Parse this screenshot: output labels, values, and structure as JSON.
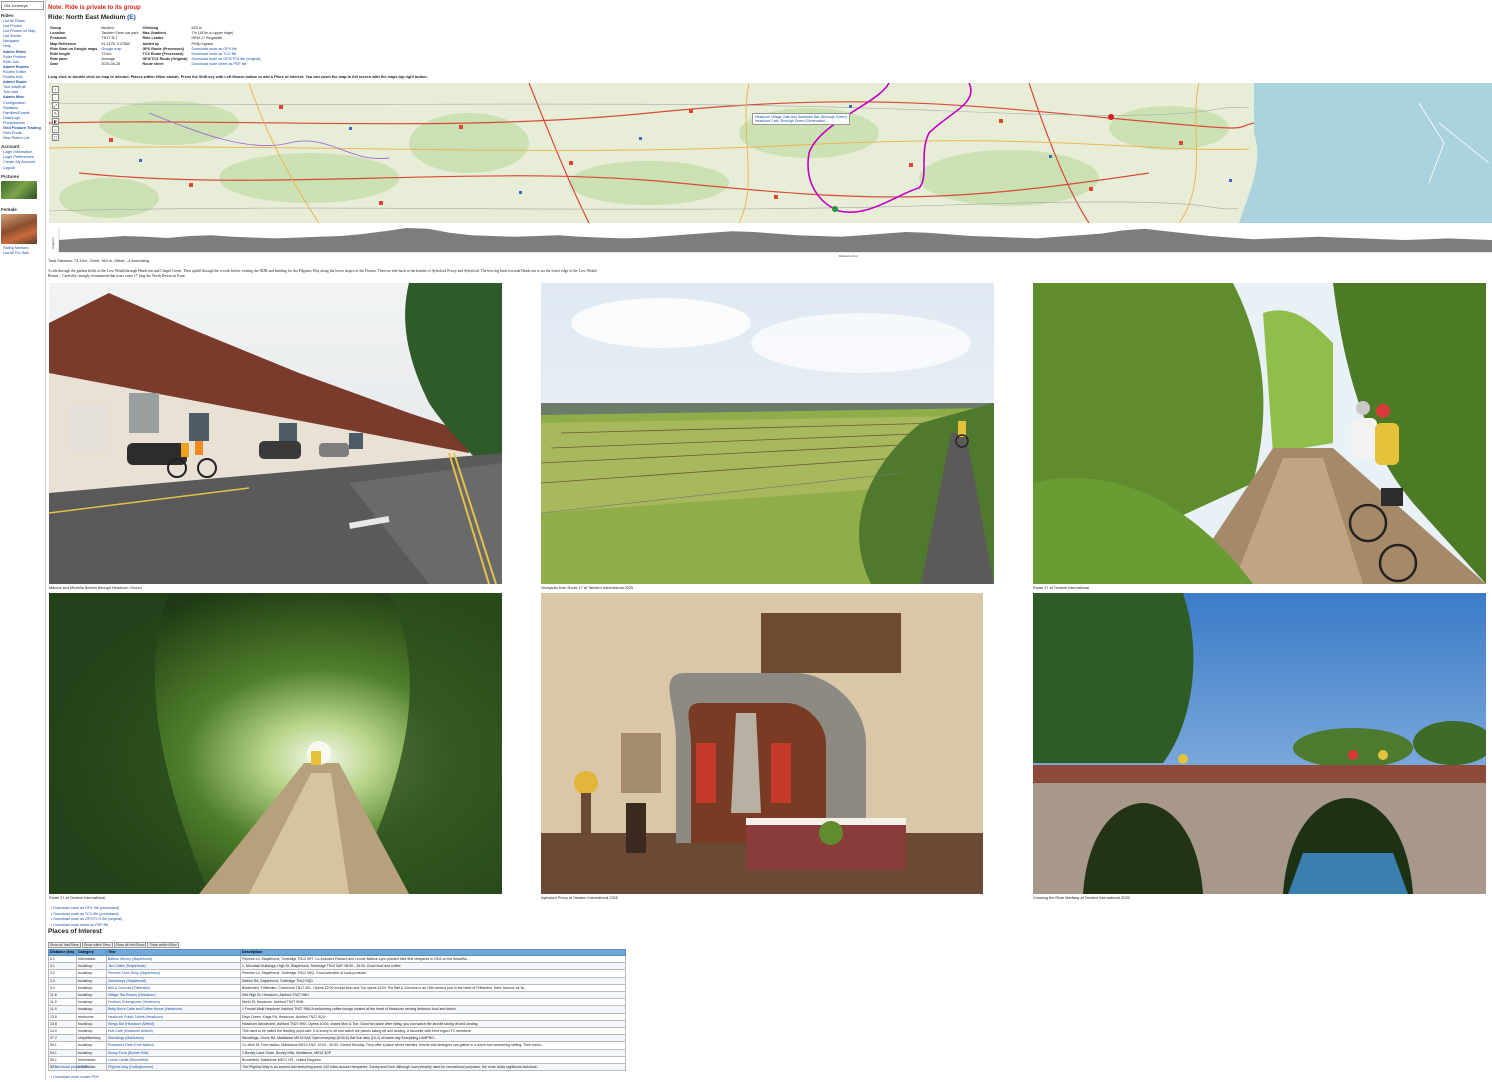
{
  "sidebar": {
    "top_link": "Old Journeys",
    "rides_heading": "Rides",
    "rides_items": [
      "List All Rides",
      "List Photos",
      "List Photos on Map",
      "List Shorts",
      "Navigator",
      "Help",
      "Admin Rides",
      "Rider Profiles",
      "Ride Join",
      "Admin Routes",
      "Routes Editor",
      "Routes Add",
      "Admin Route",
      "Tour Add/Edit",
      "Tour Add",
      "Admin Misc",
      "Configuration",
      "Statistics",
      "Families/Emails",
      "Data/Logs",
      "Photo/Issues",
      "Grid Posture Trading",
      "Path Route",
      "New Riders List"
    ],
    "account_heading": "Account",
    "account_items": [
      "Login Information",
      "Login Preferences",
      "Create My Account",
      "Logout"
    ],
    "pictures_heading": "Pictures",
    "female_heading": "Female",
    "bottom_items": [
      "Riding Mentors",
      "List All For Sale"
    ]
  },
  "page": {
    "note": "Note: Ride is private to its group",
    "title_prefix": "Ride: North East Medium",
    "title_code": "(E)"
  },
  "info_rows": [
    {
      "k1": "Group",
      "v1": "tandem",
      "k2": "Climbing",
      "v2": "625 m"
    },
    {
      "k1": "Location",
      "v1": "Tandem Farm car park",
      "k2": "Max Gradient",
      "v2": "7% (192m to upper ridge)"
    },
    {
      "k1": "Postcode",
      "v1": "TN17 3LT",
      "k2": "Ride Leader",
      "v2": "HRM 17 Kingsdale"
    },
    {
      "k1": "Map Reference",
      "v1": "51.1476, 0.47860",
      "k2": "Added by",
      "v2": "Philip Ingram"
    },
    {
      "k1": "Ride Start on Google maps",
      "v1": "Google map",
      "k2": "GPX Route (Processed)",
      "v2": "Download route as GPX file"
    },
    {
      "k1": "Ride length",
      "v1": "73 km",
      "k2": "TCX Route (Processed)",
      "v2": "Download route as TCX file"
    },
    {
      "k1": "Ride pace",
      "v1": "Average",
      "k2": "GPX/TCX Route (Original)",
      "v2": "Download route as GPX/TCX file (original)"
    },
    {
      "k1": "Date",
      "v1": "2025-06-28",
      "k2": "Route sheet",
      "v2": "Download route sheet as PDF file"
    }
  ],
  "map_hint": "Long click or double click on map to interact. Places within 60km shown. Press the Shift key with Left Mouse button to add a Place of Interest. You can zoom the map to full screen with the maps top right button.",
  "map": {
    "tooltip_line1": "Headcorn Village Cafe And Sandwich Bar (Borough Green)",
    "tooltip_line2": "Headcorn Cafe, Borough Green (Sevenoaks)",
    "controls": [
      "+",
      "−",
      "⤢",
      "✎",
      "◧",
      "⌂",
      "▢"
    ]
  },
  "elevation": {
    "ylabel": "Height m",
    "xlabel": "Distance (km)",
    "profile": [
      30,
      34,
      36,
      40,
      38,
      35,
      40,
      42,
      38,
      36,
      34,
      36,
      38,
      40,
      45,
      52,
      60,
      58,
      48,
      42,
      40,
      38,
      40,
      42,
      38,
      36,
      34,
      36,
      40,
      44,
      48,
      52,
      50,
      46,
      42,
      40,
      38,
      42,
      46,
      50,
      48,
      44,
      40,
      38,
      36,
      34,
      38,
      42,
      46,
      54,
      58,
      52,
      46,
      40,
      36,
      32,
      34,
      36,
      38,
      36,
      34,
      32,
      30,
      32,
      34,
      32,
      30
    ]
  },
  "distance_line": "Total Distance: 73.3 km, Climb: 964 m, Offset: –4 Ascending",
  "description": "A ride through the garden fields of the Low Weald through Headcorn and Chapel Green. Then uphill through the woods before visiting the NDR and heading for the Pilgrims Way along the lower slopes of the Downs. Then we ride back to the hamlet of Aylesford Priory and Aylesford. The best leg back towards Headcorn is via the lower edge of the Low Weald.",
  "description2": "Return – Carefully strongly recommend that users route 17 long the North Downs in Kent",
  "photos": [
    {
      "caption": "Marcus and Michelle Beeton through Headcorn Church"
    },
    {
      "caption": "Vineyards from Route 17 at Tandem International 2025"
    },
    {
      "caption": "Route 17 at Tandem International"
    },
    {
      "caption": "Route 17 at Tandem International"
    },
    {
      "caption": "Aylesford Priory at Tandem International 2025"
    },
    {
      "caption": "Crossing the River Medway at Tandem International 2025"
    }
  ],
  "downloads": [
    "Download route as GPX file (processed)",
    "Download route as TCX file (processed)",
    "Download route as GPX/TCX file (original)",
    "Download route sheet as PDF file"
  ],
  "poi": {
    "heading": "Places of Interest",
    "buttons": [
      "Show all Info/Show",
      "Show within Desc",
      "Show all Info/Show",
      "Show within 60km"
    ],
    "columns": [
      "Distance (km)",
      "Category",
      "Title",
      "Description"
    ],
    "rows": [
      [
        "0.1",
        "Information",
        "Balfour Winery (Staplehurst)",
        "Pennies Ln, Staplehurst, Tonbridge TN12 0HT. Co-founders Richard and Leonie Balfour-Lynn planted their first vineyards in 2002 on the beautiful..."
      ],
      [
        "3.1",
        "foodshop",
        "Jim Coffee (Staplehurst)",
        "1, Mountain Buildings, High St, Staplehurst, Tonbridge TN12 0AP. 08:00 - 16:00. Good food and coffee"
      ],
      [
        "3.2",
        "foodshop",
        "Pennies Farm Shop (Staplehurst)",
        "Pennies Ln, Staplehurst, Tonbridge TN12 0HQ. Good selection of local products."
      ],
      [
        "3.3",
        "foodshop",
        "Sainsburys (Staplehurst)",
        "Station Rd, Staplehurst, Tonbridge TN12 0QD"
      ],
      [
        "5.4",
        "foodshop",
        "Bell & Jorrocks (Frittenden)",
        "Biddenden, Frittenden, Cranbrook TN17 2EL. Opens 12:00 except Mon and Tue opens 16:00 The Bell & Jorrocks is an 18th century pub in the heart of Frittenden, Kent, famous for its..."
      ],
      [
        "11.8",
        "foodshop",
        "Village Tea Rooms (Headcorn)",
        "59A High St, Headcorn, Ashford TN27 9NH"
      ],
      [
        "11.9",
        "foodshop",
        "Fordons Greengrocer (Headcorn)",
        "North St, Headcorn, Ashford TN27 9NN"
      ],
      [
        "11.9",
        "foodshop",
        "Betty Boo's Cake and Coffee House (Headcorn)",
        "1 Forstal Walk Headcorn Ashford TN27 9NN A welcoming coffee lounge located at the heart of Headcorn serving delicious food and drinks"
      ],
      [
        "13.5",
        "restrooms",
        "Headcorn Public Toilets (Headcorn)",
        "Days Green, Kings Rd, Headcorn, Ashford TN27 9QU"
      ],
      [
        "13.8",
        "foodshop",
        "Wings Bar (Headcorn Airfield)",
        "Headcorn Aerodrome, Ashford TN27 9HX. Opens 10:00, closed Mon & Tue. Good fun place after riding, you can watch the aircraft taking off and landing."
      ],
      [
        "14.0",
        "foodshop",
        "Hub Cafe (Headcorn Airfield)",
        "This used to be called the flooding point cafe. It is lovely to sit and watch the planes taking off and landing. A favourite with Kent region TC members."
      ],
      [
        "37.2",
        "shop/bikeshop",
        "Woodlings (Maidstone)",
        "Woodlings, Grove Rd, Maidstone ME15 9AS Open everyday (8:30-5) Sat Sun also (10-2) all same day Everything LAMPRO..."
      ],
      [
        "39.1",
        "foodshop",
        "Postman's Rest (Fore station)",
        "Co-Weir St, Fore station, Maidstone ME14 1NX. 10:00 - 20:00. Closed Monday. They offer a place where families, friends and strangers can gather in a warm and welcoming setting. Their menu..."
      ],
      [
        "54.1",
        "foodshop",
        "Scoop Food (Boxlee Hills)",
        "1 Boxley Lane Close, Boxley Hills, Maidstone, ME14 3DP"
      ],
      [
        "55.1",
        "Information",
        "Leeds Castle (Broomfield)",
        "Broomfield, Maidstone ME17 1PL, United Kingdom"
      ],
      [
        "57.2",
        "Information",
        "Pilgrims Way (Hollingbourne)",
        "The Pilgrims Way is an ancient trail stretching some 120 miles across Hampshire, Surrey and Kent. Although now primarily used for recreational purposes, the route holds significant historical..."
      ]
    ]
  },
  "bottom_links": [
    "Download photo PDF",
    "Download more routes PDF"
  ],
  "colors": {
    "note_red": "#d6261c",
    "link_blue": "#1a4fa3",
    "table_header": "#6fa8dc",
    "route_magenta": "#c400c4",
    "sea": "#aad3df",
    "elevation_fill": "#7d7d7d"
  }
}
